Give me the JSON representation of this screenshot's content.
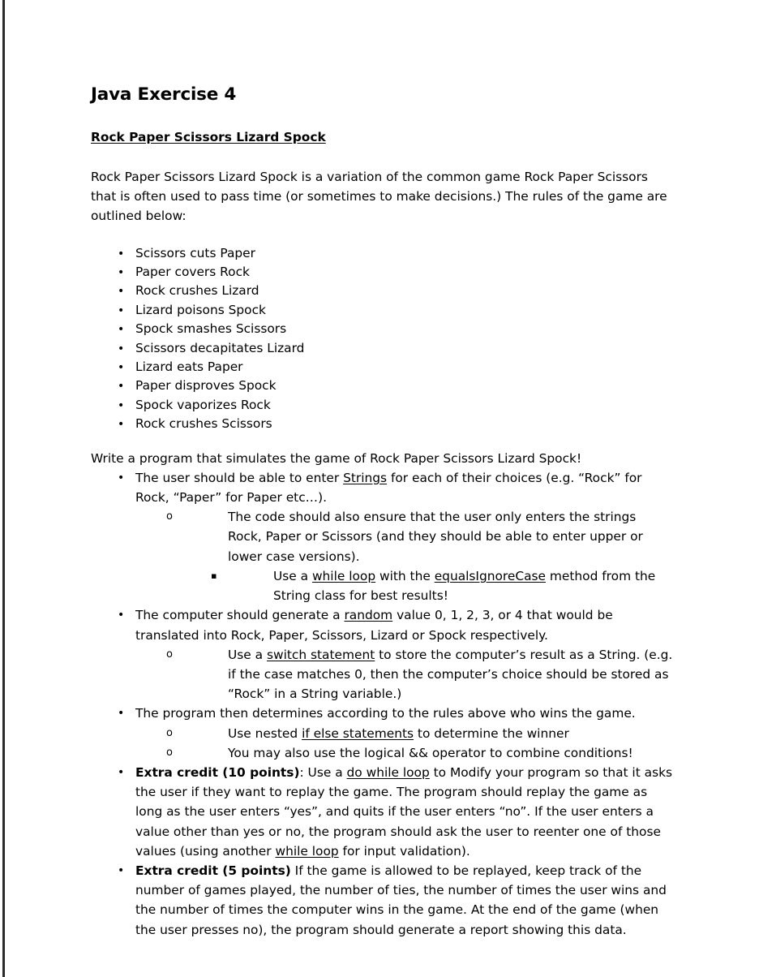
{
  "document": {
    "title": "Java Exercise 4",
    "subheading": "Rock Paper Scissors Lizard Spock",
    "intro_paragraph": "Rock Paper Scissors Lizard Spock is a variation of the common game Rock Paper Scissors that is often used to pass time (or sometimes to make decisions.) The rules of the game are outlined below:",
    "write_program_line": "Write a program that simulates the game of Rock Paper Scissors Lizard Spock!"
  },
  "rules": {
    "marker": "•",
    "items": [
      "Scissors cuts Paper",
      "Paper covers Rock",
      "Rock crushes Lizard",
      "Lizard poisons Spock",
      "Spock smashes Scissors",
      "Scissors decapitates Lizard",
      "Lizard eats Paper",
      "Paper disproves Spock",
      "Spock vaporizes Rock",
      "Rock crushes Scissors"
    ]
  },
  "markers": {
    "level1": "•",
    "level2": "o",
    "level3": "▪"
  },
  "specification": [
    {
      "level": 1,
      "segments": [
        {
          "text": "The user should be able to enter "
        },
        {
          "text": "Strings",
          "underline": true
        },
        {
          "text": " for each of their choices (e.g. “Rock” for Rock, “Paper” for Paper etc…)."
        }
      ]
    },
    {
      "level": 2,
      "segments": [
        {
          "text": "The code should also ensure that the user only enters the strings Rock, Paper or Scissors (and they should be able to enter upper or lower case versions)."
        }
      ]
    },
    {
      "level": 3,
      "segments": [
        {
          "text": "Use a "
        },
        {
          "text": "while loop",
          "underline": true
        },
        {
          "text": " with the "
        },
        {
          "text": "equalsIgnoreCase",
          "underline": true
        },
        {
          "text": " method from the String class for best results!"
        }
      ]
    },
    {
      "level": 1,
      "segments": [
        {
          "text": "The computer should generate a "
        },
        {
          "text": "random",
          "underline": true
        },
        {
          "text": " value 0, 1, 2, 3, or 4 that would be translated into Rock, Paper, Scissors, Lizard or Spock respectively."
        }
      ]
    },
    {
      "level": 2,
      "segments": [
        {
          "text": "Use a "
        },
        {
          "text": "switch statement",
          "underline": true
        },
        {
          "text": " to store the computer’s result as a String. (e.g. if the case matches 0, then the computer’s choice should be stored as “Rock” in a String variable.)"
        }
      ]
    },
    {
      "level": 1,
      "segments": [
        {
          "text": "The program then determines according to the rules above who wins the game."
        }
      ]
    },
    {
      "level": 2,
      "segments": [
        {
          "text": "Use nested "
        },
        {
          "text": "if else statements",
          "underline": true
        },
        {
          "text": " to determine the winner"
        }
      ]
    },
    {
      "level": 2,
      "segments": [
        {
          "text": "You may also use the logical && operator to combine conditions!"
        }
      ]
    },
    {
      "level": 1,
      "segments": [
        {
          "text": "Extra credit (10 points)",
          "bold": true
        },
        {
          "text": ": Use a "
        },
        {
          "text": "do while loop",
          "underline": true
        },
        {
          "text": " to Modify your program so that it asks the user if they want to replay the game. The program should replay the game as long as the user enters “yes”, and quits if the user enters “no”. If the user enters a value other than yes or no, the program should ask the user to reenter one of those values (using another "
        },
        {
          "text": "while loop",
          "underline": true
        },
        {
          "text": " for input validation)."
        }
      ]
    },
    {
      "level": 1,
      "segments": [
        {
          "text": "Extra credit (5 points)",
          "bold": true
        },
        {
          "text": " If the game is allowed to be replayed, keep track of the number of games played, the number of ties, the number of times the user wins and the number of times the computer wins in the game. At the end of the game (when the user presses no), the program should generate a report showing this data."
        }
      ]
    }
  ]
}
